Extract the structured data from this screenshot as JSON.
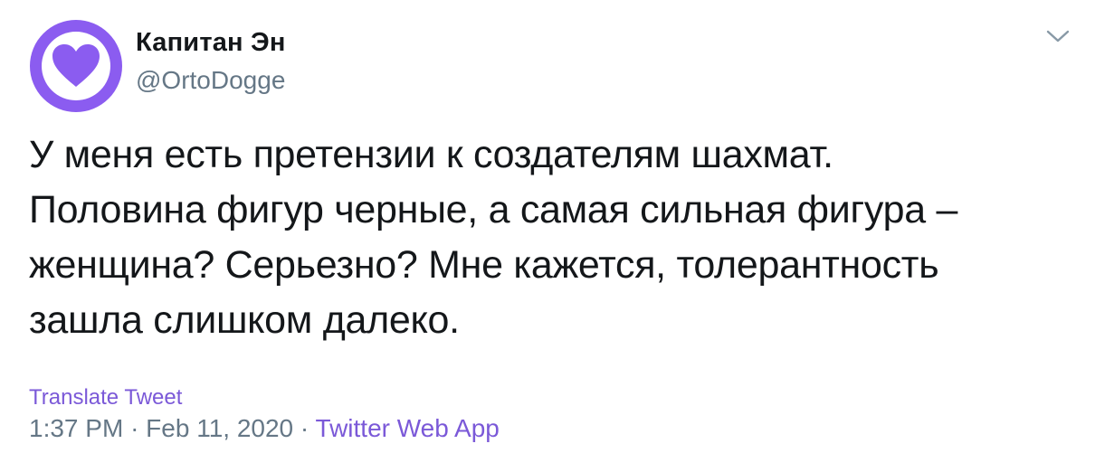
{
  "author": {
    "name": "Капитан Эн",
    "handle": "@OrtoDogge",
    "avatar_color": "#8b5cf0",
    "avatar_icon": "heart-icon"
  },
  "tweet": {
    "text_lines": [
      "У меня есть претензии к создателям шахмат.",
      "Половина фигур черные, а самая сильная фигура –",
      "женщина? Серьезно? Мне кажется, толерантность",
      "зашла слишком далеко."
    ],
    "translate_label": "Translate Tweet",
    "time": "1:37 PM",
    "date": "Feb 11, 2020",
    "separator": "·",
    "source": "Twitter Web App"
  },
  "menu_icon": "chevron-down-icon",
  "colors": {
    "accent": "#7b59d8",
    "text": "#14171a",
    "secondary": "#657786"
  }
}
